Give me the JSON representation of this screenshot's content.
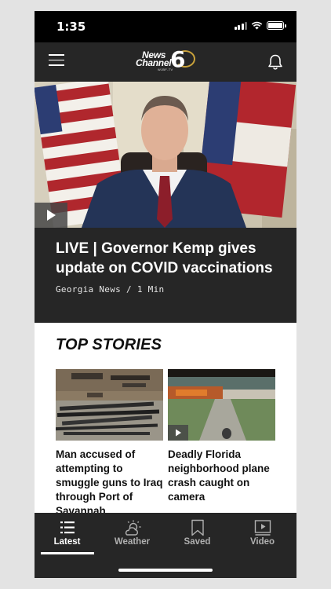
{
  "status_bar": {
    "time": "1:35"
  },
  "header": {
    "logo": {
      "line1": "News",
      "line2": "Channel",
      "number": "6",
      "sub": "WJBF-TV"
    }
  },
  "hero": {
    "title": "LIVE | Governor Kemp gives update on COVID vaccinations",
    "meta": "Georgia News / 1 Min"
  },
  "top_stories": {
    "heading": "TOP STORIES",
    "items": [
      {
        "title": "Man accused of attempting to smuggle guns to Iraq through Port of Savannah",
        "has_video": false
      },
      {
        "title": "Deadly Florida neighborhood plane crash caught on camera",
        "has_video": true
      }
    ]
  },
  "tab_bar": {
    "tabs": [
      {
        "label": "Latest",
        "icon": "list-icon",
        "active": true
      },
      {
        "label": "Weather",
        "icon": "weather-icon",
        "active": false
      },
      {
        "label": "Saved",
        "icon": "bookmark-icon",
        "active": false
      },
      {
        "label": "Video",
        "icon": "video-icon",
        "active": false
      }
    ]
  },
  "colors": {
    "header_bg": "#262626",
    "page_bg": "#e3e3e3",
    "logo_gold": "#c9a23b"
  }
}
